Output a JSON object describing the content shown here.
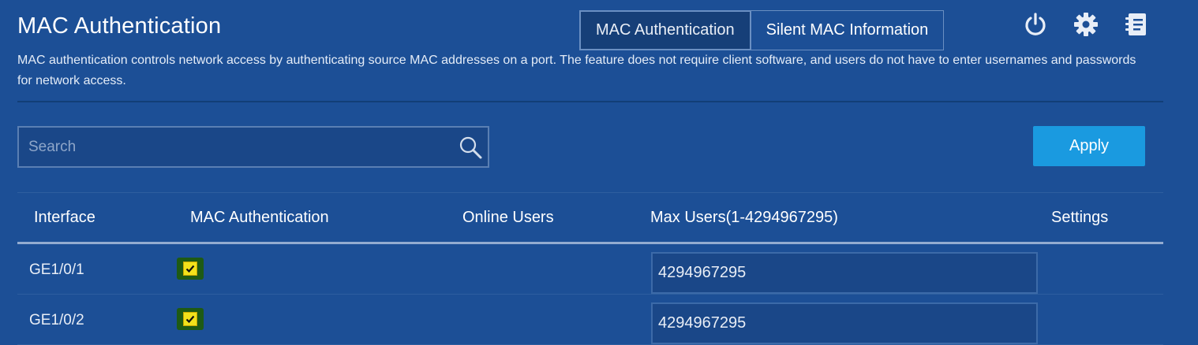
{
  "header": {
    "title": "MAC Authentication",
    "description": "MAC authentication controls network access by authenticating source MAC addresses on a port. The feature does not require client software, and users do not have to enter usernames and passwords for network access."
  },
  "tabs": [
    {
      "label": "MAC Authentication",
      "active": true
    },
    {
      "label": "Silent MAC Information",
      "active": false
    }
  ],
  "top_icons": [
    "power-icon",
    "gear-icon",
    "notebook-icon"
  ],
  "search": {
    "placeholder": "Search",
    "value": ""
  },
  "apply_label": "Apply",
  "table": {
    "columns": [
      "Interface",
      "MAC Authentication",
      "Online Users",
      "Max Users(1-4294967295)",
      "Settings"
    ],
    "rows": [
      {
        "interface": "GE1/0/1",
        "mac_auth": true,
        "online_users": "",
        "max_users": "4294967295",
        "settings": ""
      },
      {
        "interface": "GE1/0/2",
        "mac_auth": true,
        "online_users": "",
        "max_users": "4294967295",
        "settings": ""
      }
    ]
  },
  "colors": {
    "background": "#1c4f96",
    "apply": "#1a9ae0",
    "checkbox": "#f2e21b"
  }
}
